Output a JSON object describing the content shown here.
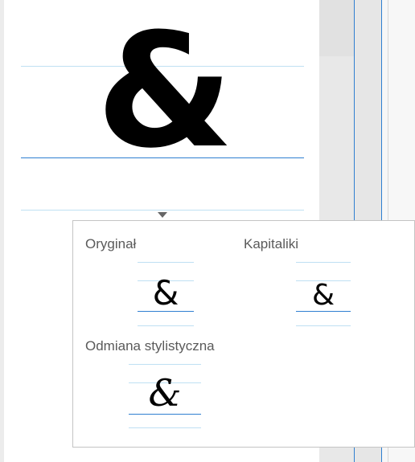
{
  "preview": {
    "glyph": "&"
  },
  "popup": {
    "options": [
      {
        "label": "Oryginał",
        "glyph": "&"
      },
      {
        "label": "Kapitaliki",
        "glyph": "&"
      },
      {
        "label": "Odmiana stylistyczna",
        "glyph": "&"
      }
    ]
  },
  "colors": {
    "guide_light": "#bfe0f3",
    "baseline_blue": "#2f7fd1",
    "label_gray": "#5a5a5a"
  }
}
